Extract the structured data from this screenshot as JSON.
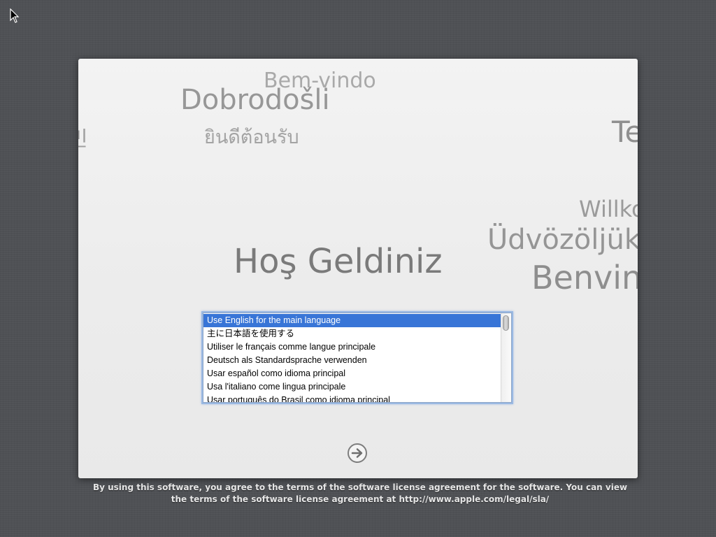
{
  "welcome_words": {
    "bem_vindo": "Bem-vindo",
    "dobrodosli": "Dobrodošli",
    "thai": "ยินดีต้อนรับ",
    "left_partial": "민",
    "te_partial": "Te",
    "willkommen_partial": "Willko",
    "udvozoljuk_partial": "Üdvözöljük",
    "benvenuto_partial": "Benvin",
    "hos_geldiniz": "Hoş Geldiniz"
  },
  "language_list": {
    "items": [
      "Use English for the main language",
      "主に日本語を使用する",
      "Utiliser le français comme langue principale",
      "Deutsch als Standardsprache verwenden",
      "Usar español como idioma principal",
      "Usa l'italiano come lingua principale",
      "Usar português do Brasil como idioma principal"
    ],
    "selected_index": 0
  },
  "continue_button": {
    "icon": "arrow-right-circle-icon"
  },
  "license": {
    "line1": "By using this software, you agree to the terms of the software license agreement for the software. You can view",
    "line2": "the terms of the software license agreement at http://www.apple.com/legal/sla/"
  },
  "colors": {
    "selection": "#3875d7",
    "background": "#4f5155"
  }
}
